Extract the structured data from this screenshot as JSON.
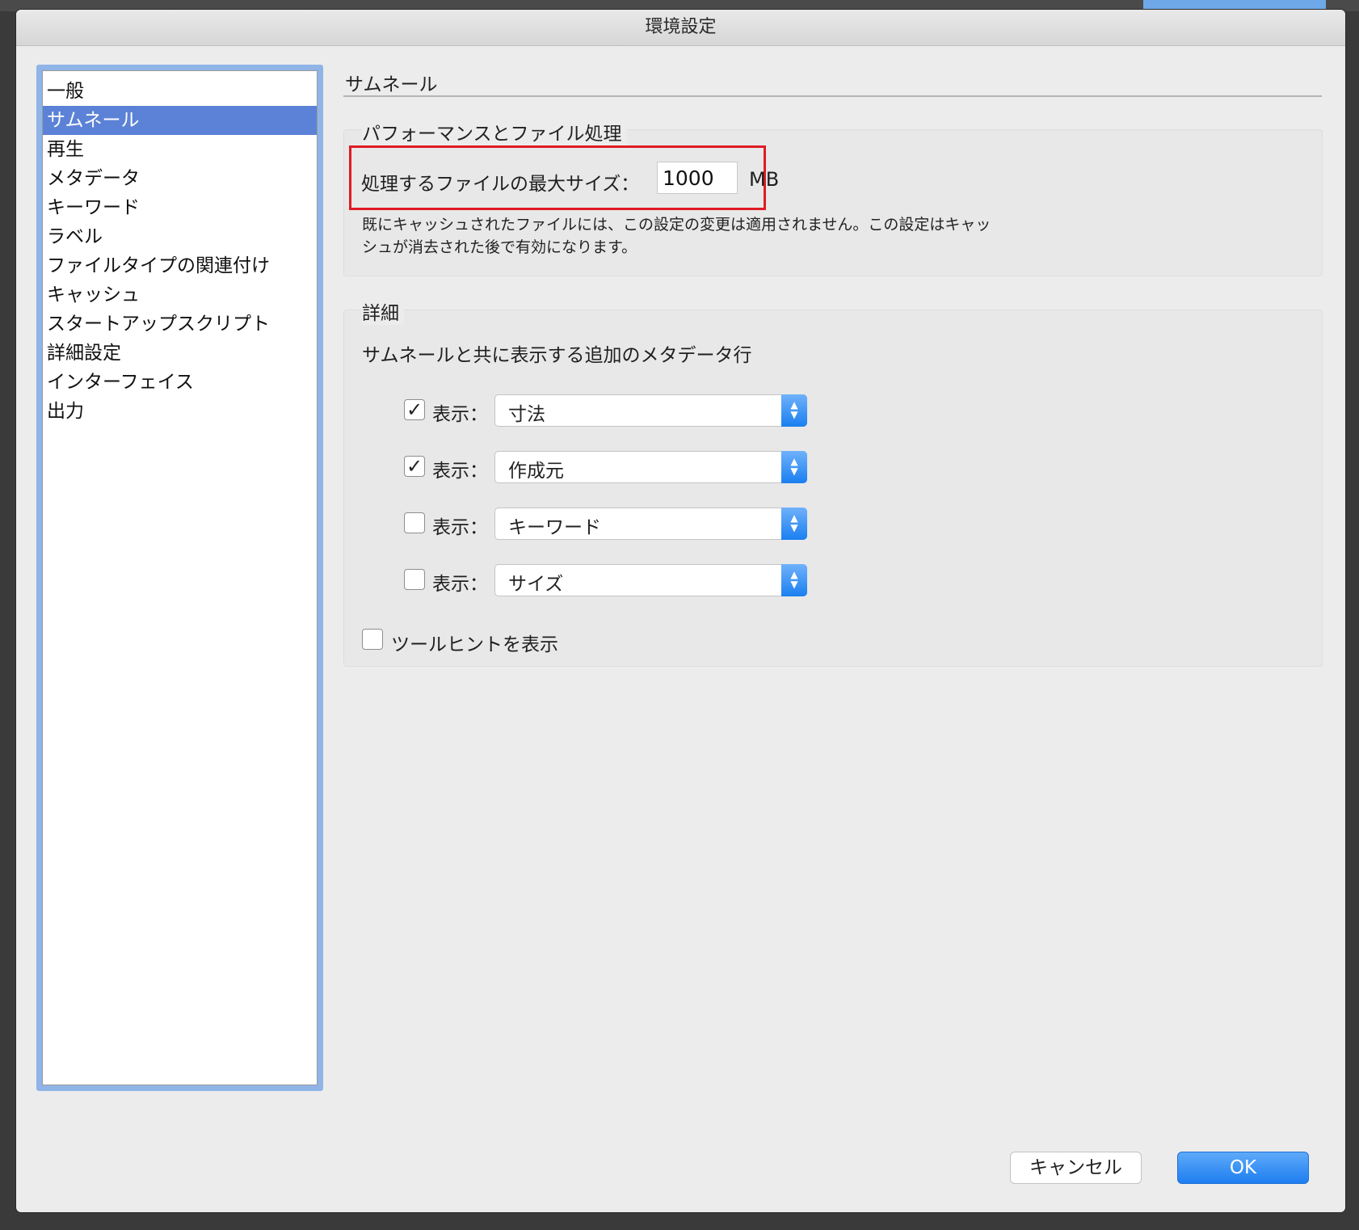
{
  "dialog": {
    "title": "環境設定"
  },
  "sidebar": {
    "items": [
      {
        "label": "一般"
      },
      {
        "label": "サムネール",
        "selected": true
      },
      {
        "label": "再生"
      },
      {
        "label": "メタデータ"
      },
      {
        "label": "キーワード"
      },
      {
        "label": "ラベル"
      },
      {
        "label": "ファイルタイプの関連付け"
      },
      {
        "label": "キャッシュ"
      },
      {
        "label": "スタートアップスクリプト"
      },
      {
        "label": "詳細設定"
      },
      {
        "label": "インターフェイス"
      },
      {
        "label": "出力"
      }
    ]
  },
  "panel": {
    "title": "サムネール",
    "performance": {
      "group_label": "パフォーマンスとファイル処理",
      "max_size_label": "処理するファイルの最大サイズ：",
      "max_size_value": "1000",
      "unit": "MB",
      "note": "既にキャッシュされたファイルには、この設定の変更は適用されません。この設定はキャッシュが消去された後で有効になります。"
    },
    "details": {
      "group_label": "詳細",
      "heading": "サムネールと共に表示する追加のメタデータ行",
      "rows": [
        {
          "checked": true,
          "label": "表示：",
          "value": "寸法"
        },
        {
          "checked": true,
          "label": "表示：",
          "value": "作成元"
        },
        {
          "checked": false,
          "label": "表示：",
          "value": "キーワード"
        },
        {
          "checked": false,
          "label": "表示：",
          "value": "サイズ"
        }
      ],
      "tooltip": {
        "checked": false,
        "label": "ツールヒントを表示"
      }
    }
  },
  "buttons": {
    "cancel": "キャンセル",
    "ok": "OK"
  },
  "icons": {
    "check": "✓",
    "stepper": "⌃⌄"
  },
  "colors": {
    "accent": "#1e7ef0",
    "selection": "#5b82d6",
    "highlight": "#e01b24"
  }
}
